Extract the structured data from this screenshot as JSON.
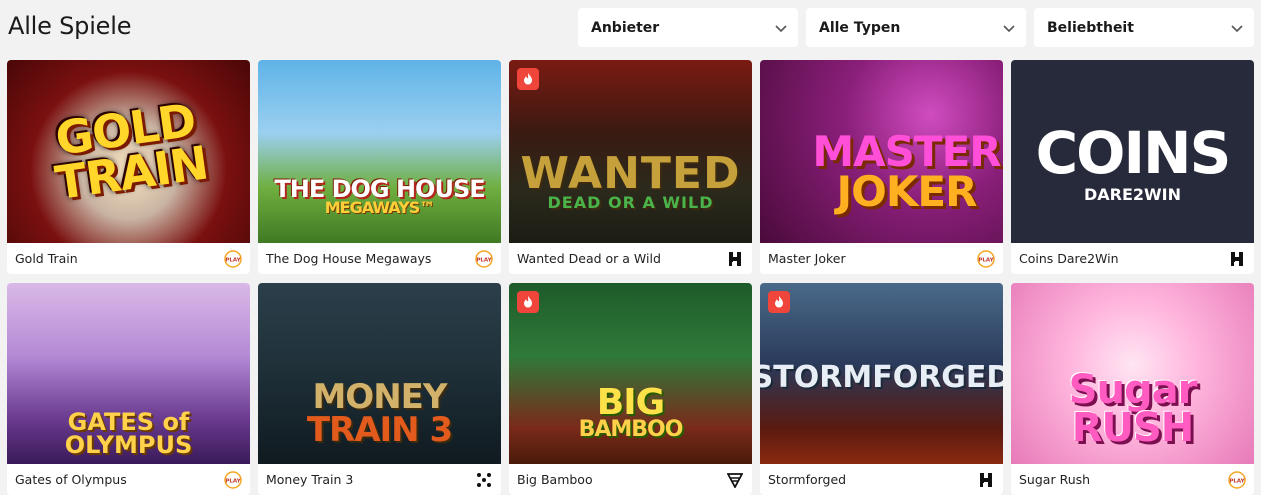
{
  "page": {
    "title": "Alle Spiele"
  },
  "filters": {
    "provider": "Anbieter",
    "type": "Alle Typen",
    "sort": "Beliebtheit"
  },
  "games": [
    {
      "name": "Gold Train",
      "logo": "GOLD TRAIN",
      "logo_sub": "",
      "provider_icon": "play-logo-icon",
      "hot": false
    },
    {
      "name": "The Dog House Megaways",
      "logo": "THE DOG HOUSE",
      "logo_sub": "MEGAWAYS™",
      "provider_icon": "play-logo-icon",
      "hot": false
    },
    {
      "name": "Wanted Dead or a Wild",
      "logo": "WANTED",
      "logo_sub": "DEAD OR A WILD",
      "provider_icon": "hacksaw-logo-icon",
      "hot": true
    },
    {
      "name": "Master Joker",
      "logo": "MASTER",
      "logo_sub": "JOKER",
      "provider_icon": "play-logo-icon",
      "hot": false
    },
    {
      "name": "Coins Dare2Win",
      "logo": "COINS",
      "logo_sub": "DARE2WIN",
      "provider_icon": "hacksaw-logo-icon",
      "hot": false
    },
    {
      "name": "Gates of Olympus",
      "logo": "GATES of OLYMPUS",
      "logo_sub": "",
      "provider_icon": "play-logo-icon",
      "hot": false
    },
    {
      "name": "Money Train 3",
      "logo": "MONEY",
      "logo_sub": "TRAIN 3",
      "provider_icon": "relax-dots-icon",
      "hot": false
    },
    {
      "name": "Big Bamboo",
      "logo": "BIG",
      "logo_sub": "BAMBOO",
      "provider_icon": "push-gaming-icon",
      "hot": true
    },
    {
      "name": "Stormforged",
      "logo": "STORMFORGED",
      "logo_sub": "",
      "provider_icon": "hacksaw-logo-icon",
      "hot": true
    },
    {
      "name": "Sugar Rush",
      "logo": "Sugar",
      "logo_sub": "RUSH",
      "provider_icon": "play-logo-icon",
      "hot": false
    }
  ],
  "colors": {
    "background": "#f2f2f2",
    "card": "#ffffff",
    "hot_badge": "#f0453a",
    "play_logo": "#f5a623"
  }
}
